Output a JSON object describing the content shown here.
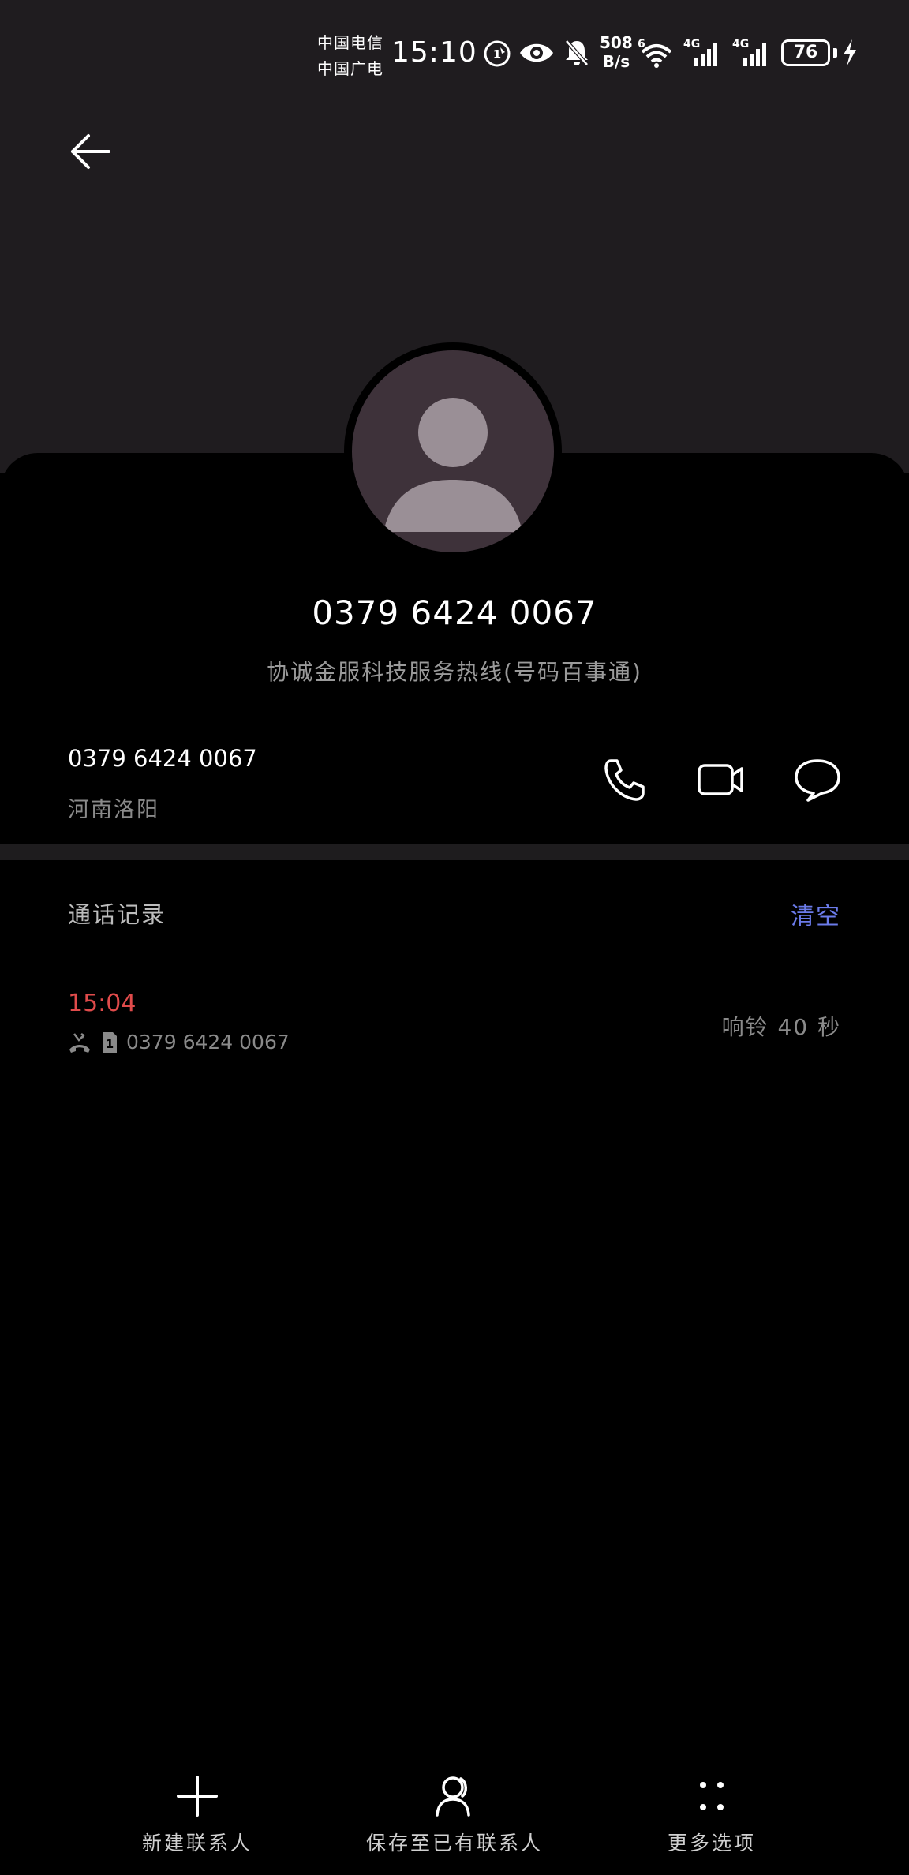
{
  "status_bar": {
    "carrier_1": "中国电信",
    "carrier_2": "中国广电",
    "time": "15:10",
    "net_speed_value": "508",
    "net_speed_unit": "B/s",
    "battery": "76",
    "icons": [
      "hd-call-icon",
      "eye-icon",
      "mute-bell-icon",
      "wifi-icon",
      "signal-4g-icon",
      "signal-4g-icon",
      "charging-icon"
    ]
  },
  "header": {
    "back_icon": "arrow-left-icon"
  },
  "contact": {
    "number": "0379 6424 0067",
    "label": "协诚金服科技服务热线(号码百事通)"
  },
  "phone_row": {
    "number": "0379 6424 0067",
    "location": "河南洛阳",
    "actions": [
      "phone-icon",
      "video-call-icon",
      "message-icon"
    ]
  },
  "call_log": {
    "title": "通话记录",
    "clear_label": "清空",
    "entries": [
      {
        "time": "15:04",
        "sim": "1",
        "number": "0379 6424 0067",
        "duration": "响铃 40 秒"
      }
    ]
  },
  "bottom_bar": {
    "new_contact": "新建联系人",
    "save_existing": "保存至已有联系人",
    "more_options": "更多选项"
  },
  "colors": {
    "background": "#000000",
    "header_bg": "#1f1c1f",
    "missed_call": "#e04b4b",
    "accent_link": "#6b7bea"
  }
}
